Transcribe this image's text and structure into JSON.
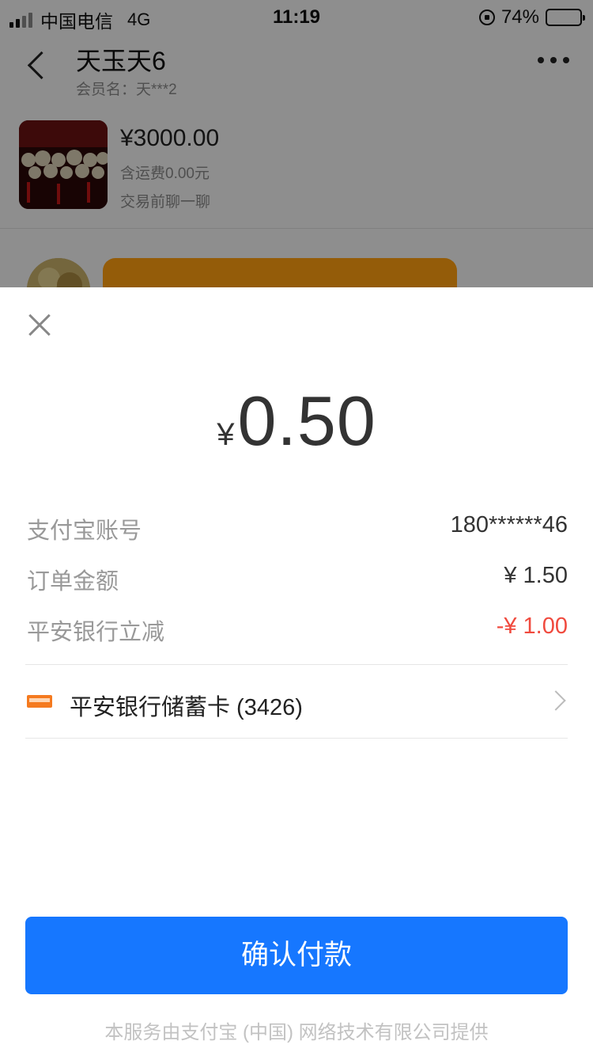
{
  "status_bar": {
    "carrier": "中国电信",
    "network": "4G",
    "time": "11:19",
    "battery": "74%",
    "battery_level": 0.74
  },
  "background": {
    "shop_title": "天玉天6",
    "member_name": "会员名：天***2",
    "product": {
      "price": "¥3000.00",
      "shipping": "含运费0.00元",
      "chat_hint": "交易前聊一聊"
    }
  },
  "payment": {
    "currency_symbol": "¥",
    "amount": "0.50",
    "details": [
      {
        "label": "支付宝账号",
        "value": "180******46"
      },
      {
        "label": "订单金额",
        "value": "¥ 1.50"
      },
      {
        "label": "平安银行立减",
        "value": "-¥ 1.00"
      }
    ],
    "method": {
      "label": "平安银行储蓄卡 (3426)",
      "icon": "bank-card-icon"
    },
    "confirm_label": "确认付款",
    "footer": "本服务由支付宝 (中国) 网络技术有限公司提供"
  },
  "colors": {
    "primary": "#1677ff",
    "discount": "#f04a3e",
    "card_icon": "#f57a1f",
    "bubble": "#ff9f10"
  }
}
